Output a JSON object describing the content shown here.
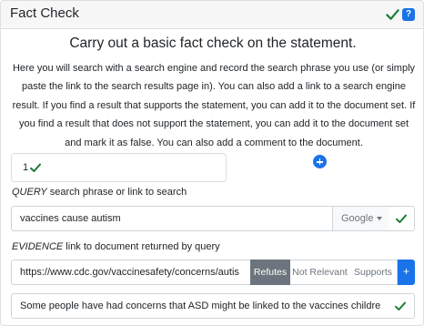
{
  "panel": {
    "title": "Fact Check",
    "help_label": "?"
  },
  "main": {
    "heading": "Carry out a basic fact check on the statement.",
    "instructions": "Here you will search with a search engine and record the search phrase you use (or simply paste the link to the search results page in). You can also add a link to a search engine result. If you find a result that supports the statement, you can add it to the document set. If you find a result that does not support the statement, you can add it to the document set and mark it as false. You can also add a comment to the document."
  },
  "item": {
    "number": "1"
  },
  "query": {
    "label_em": "QUERY",
    "label_rest": " search phrase or link to search",
    "value": "vaccines cause autism",
    "engine": "Google"
  },
  "evidence": {
    "label_em": "EVIDENCE",
    "label_rest": " link to document returned by query",
    "value": "https://www.cdc.gov/vaccinesafety/concerns/autis",
    "refutes_label": "Refutes",
    "not_relevant_label": "Not Relevant",
    "supports_label": "Supports",
    "add_label": "+"
  },
  "comment": {
    "value": "Some people have had concerns that ASD might be linked to the vaccines childre"
  },
  "colors": {
    "check": "#1e7e34",
    "accent": "#1a73e8",
    "selected_button": "#6c757d"
  },
  "icons": [
    "check-icon",
    "help-icon",
    "plus-circle-icon",
    "caret-down-icon"
  ]
}
